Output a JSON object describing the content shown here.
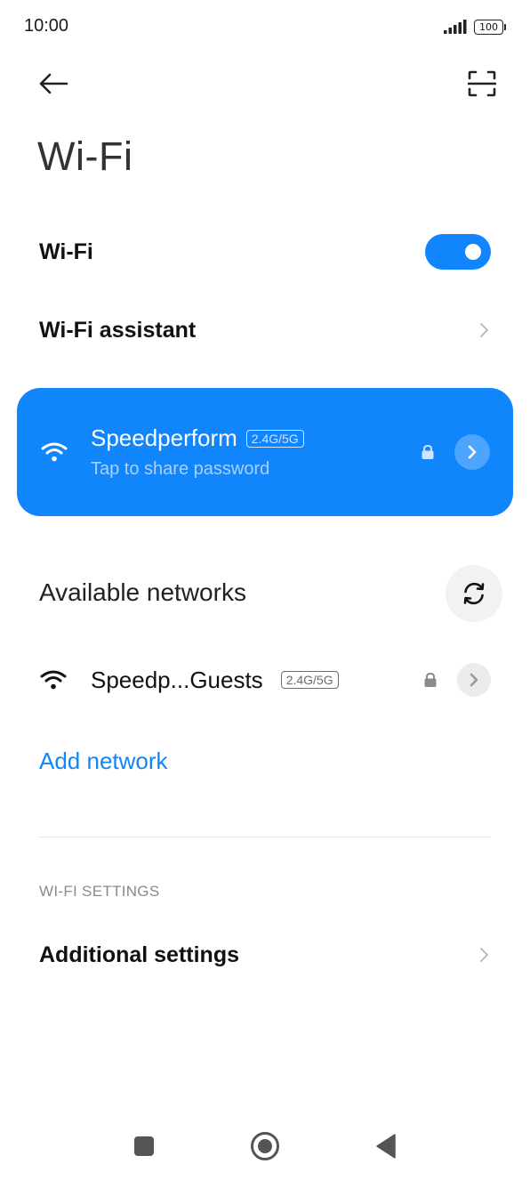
{
  "status_bar": {
    "time": "10:00",
    "battery": "100",
    "icons": [
      "signal-icon",
      "battery-icon"
    ]
  },
  "header": {
    "back_icon": "back-arrow-icon",
    "scan_icon": "qr-scan-icon",
    "title": "Wi-Fi"
  },
  "settings": {
    "wifi_label": "Wi-Fi",
    "wifi_enabled": true,
    "wifi_assistant_label": "Wi-Fi assistant"
  },
  "connected_network": {
    "ssid": "Speedperform",
    "band": "2.4G/5G",
    "subtitle": "Tap to share password",
    "secured": true,
    "icons": [
      "wifi-icon",
      "lock-icon",
      "chevron-right-icon"
    ]
  },
  "available": {
    "title": "Available networks",
    "refresh_icon": "refresh-icon",
    "networks": [
      {
        "ssid": "Speedp...Guests",
        "band": "2.4G/5G",
        "secured": true
      }
    ]
  },
  "add_network_label": "Add network",
  "wifi_settings": {
    "header": "WI-FI SETTINGS",
    "additional_label": "Additional settings"
  },
  "colors": {
    "accent": "#1085fc",
    "card_subtitle": "#a9d1ff",
    "secondary_text": "#8a8a8a"
  },
  "nav_bar": {
    "icons": [
      "recents-square-icon",
      "home-circle-icon",
      "back-triangle-icon"
    ]
  }
}
